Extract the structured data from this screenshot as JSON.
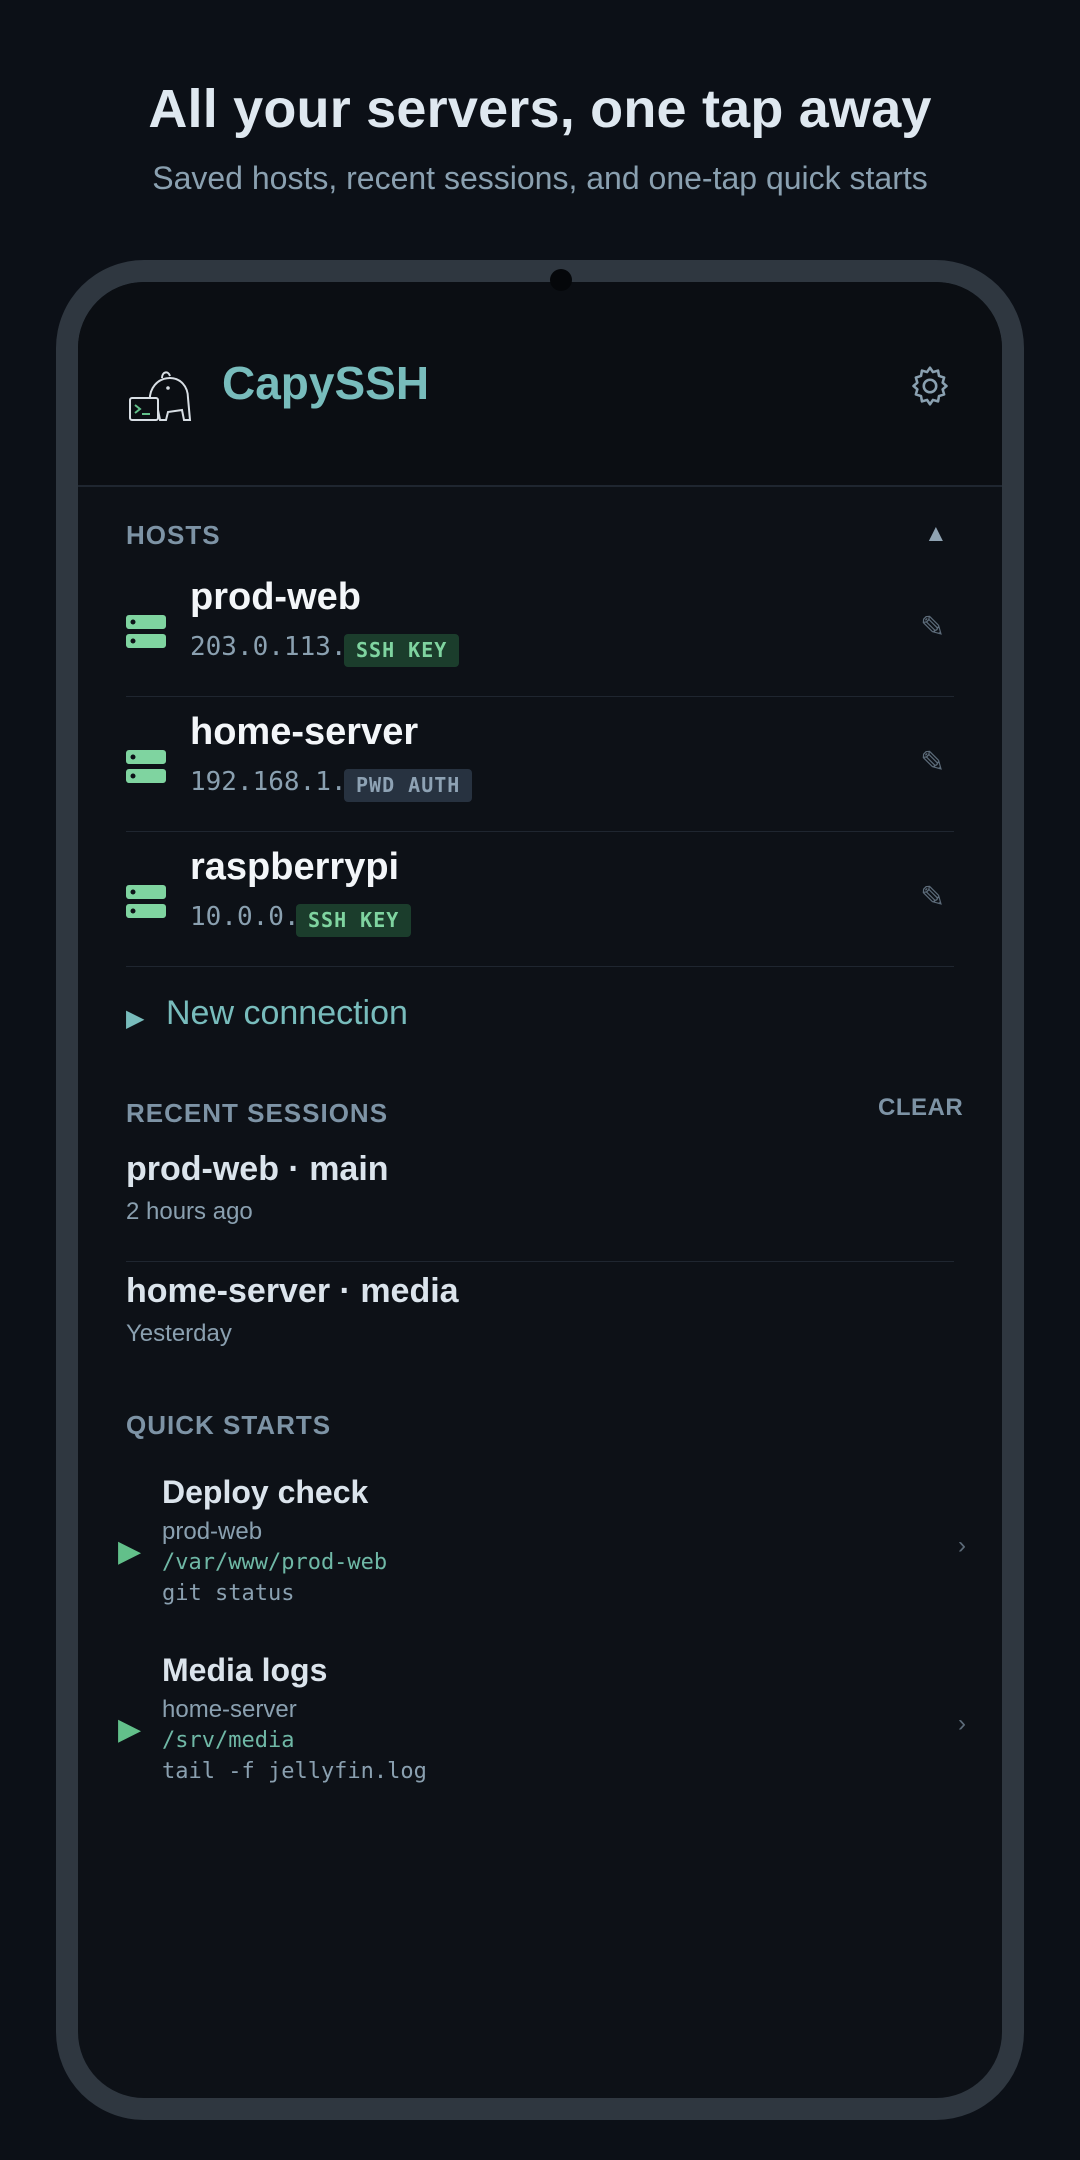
{
  "headline": "All your servers, one tap away",
  "subline": "Saved hosts, recent sessions, and one-tap quick starts",
  "app": {
    "title": "CapySSH",
    "logo_icon": "capybara-terminal-icon",
    "settings_icon": "gear-icon"
  },
  "hosts_section": {
    "label": "HOSTS",
    "toggle": "▲"
  },
  "hosts": [
    {
      "name": "prod-web",
      "address": "203.0.113.42",
      "auth": "SSH KEY",
      "edit": "✎"
    },
    {
      "name": "home-server",
      "address": "192.168.1.42",
      "auth": "PWD AUTH",
      "edit": "✎"
    },
    {
      "name": "raspberrypi",
      "address": "10.0.0.15",
      "auth": "SSH KEY",
      "edit": "✎"
    }
  ],
  "new_connection": {
    "arrow": "▶",
    "label": "New connection"
  },
  "recent": {
    "label": "RECENT SESSIONS",
    "clear": "CLEAR",
    "items": [
      {
        "title": "prod-web · main",
        "time": "2 hours ago"
      },
      {
        "title": "home-server · media",
        "time": "Yesterday"
      }
    ]
  },
  "quick_starts": {
    "label": "QUICK STARTS",
    "items": [
      {
        "title": "Deploy check",
        "host": "prod-web",
        "path": "/var/www/prod-web",
        "command": "git status",
        "play": "▶",
        "chevron": "›"
      },
      {
        "title": "Media logs",
        "host": "home-server",
        "path": "/srv/media",
        "command": "tail -f jellyfin.log",
        "play": "▶",
        "chevron": "›"
      }
    ]
  },
  "colors": {
    "accent": "#78bcbc",
    "key_badge": "#1b3d2c",
    "pwd_badge": "#273240",
    "server_icon": "#7fd4a0"
  }
}
